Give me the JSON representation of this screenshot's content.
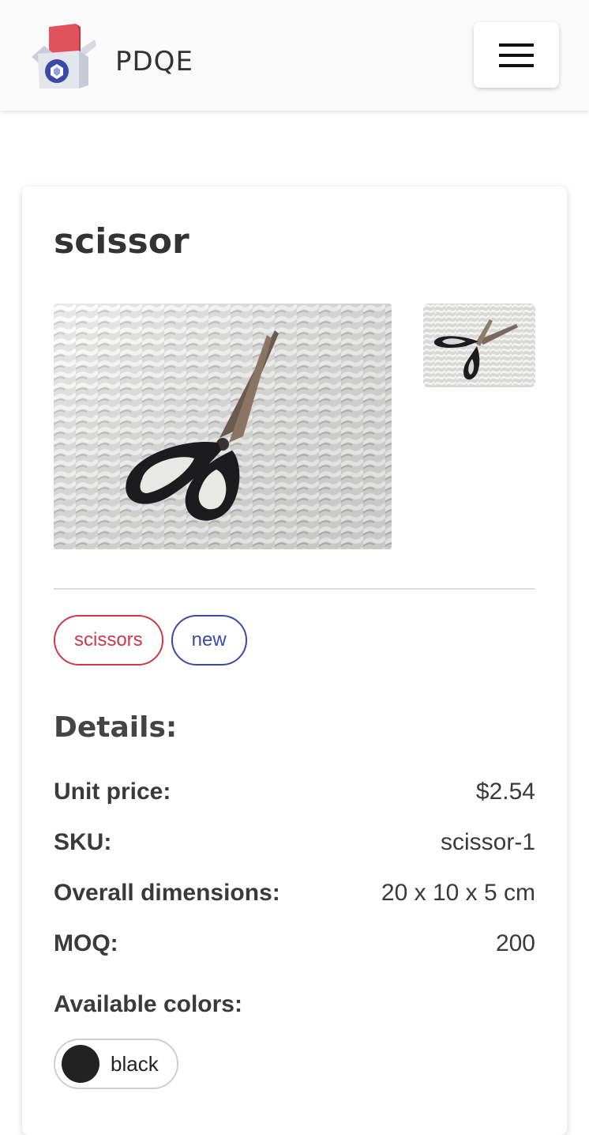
{
  "header": {
    "brand": "PDQE",
    "logo_icon": "pdqe-box-logo",
    "menu_icon": "hamburger-menu-icon"
  },
  "product": {
    "title": "scissor",
    "main_image": "scissors-on-woven-mat",
    "thumbnails": [
      "scissors-on-woven-mat-thumbnail"
    ],
    "tags": [
      {
        "label": "scissors",
        "color": "#cc3a48"
      },
      {
        "label": "new",
        "color": "#3a4aa5"
      }
    ],
    "details_heading": "Details:",
    "details": [
      {
        "label": "Unit price:",
        "value": "$2.54"
      },
      {
        "label": "SKU:",
        "value": "scissor-1"
      },
      {
        "label": "Overall dimensions:",
        "value": "20 x 10 x 5 cm"
      },
      {
        "label": "MOQ:",
        "value": "200"
      }
    ],
    "colors_label": "Available colors:",
    "colors": [
      {
        "name": "black",
        "swatch": "#222222"
      }
    ]
  }
}
